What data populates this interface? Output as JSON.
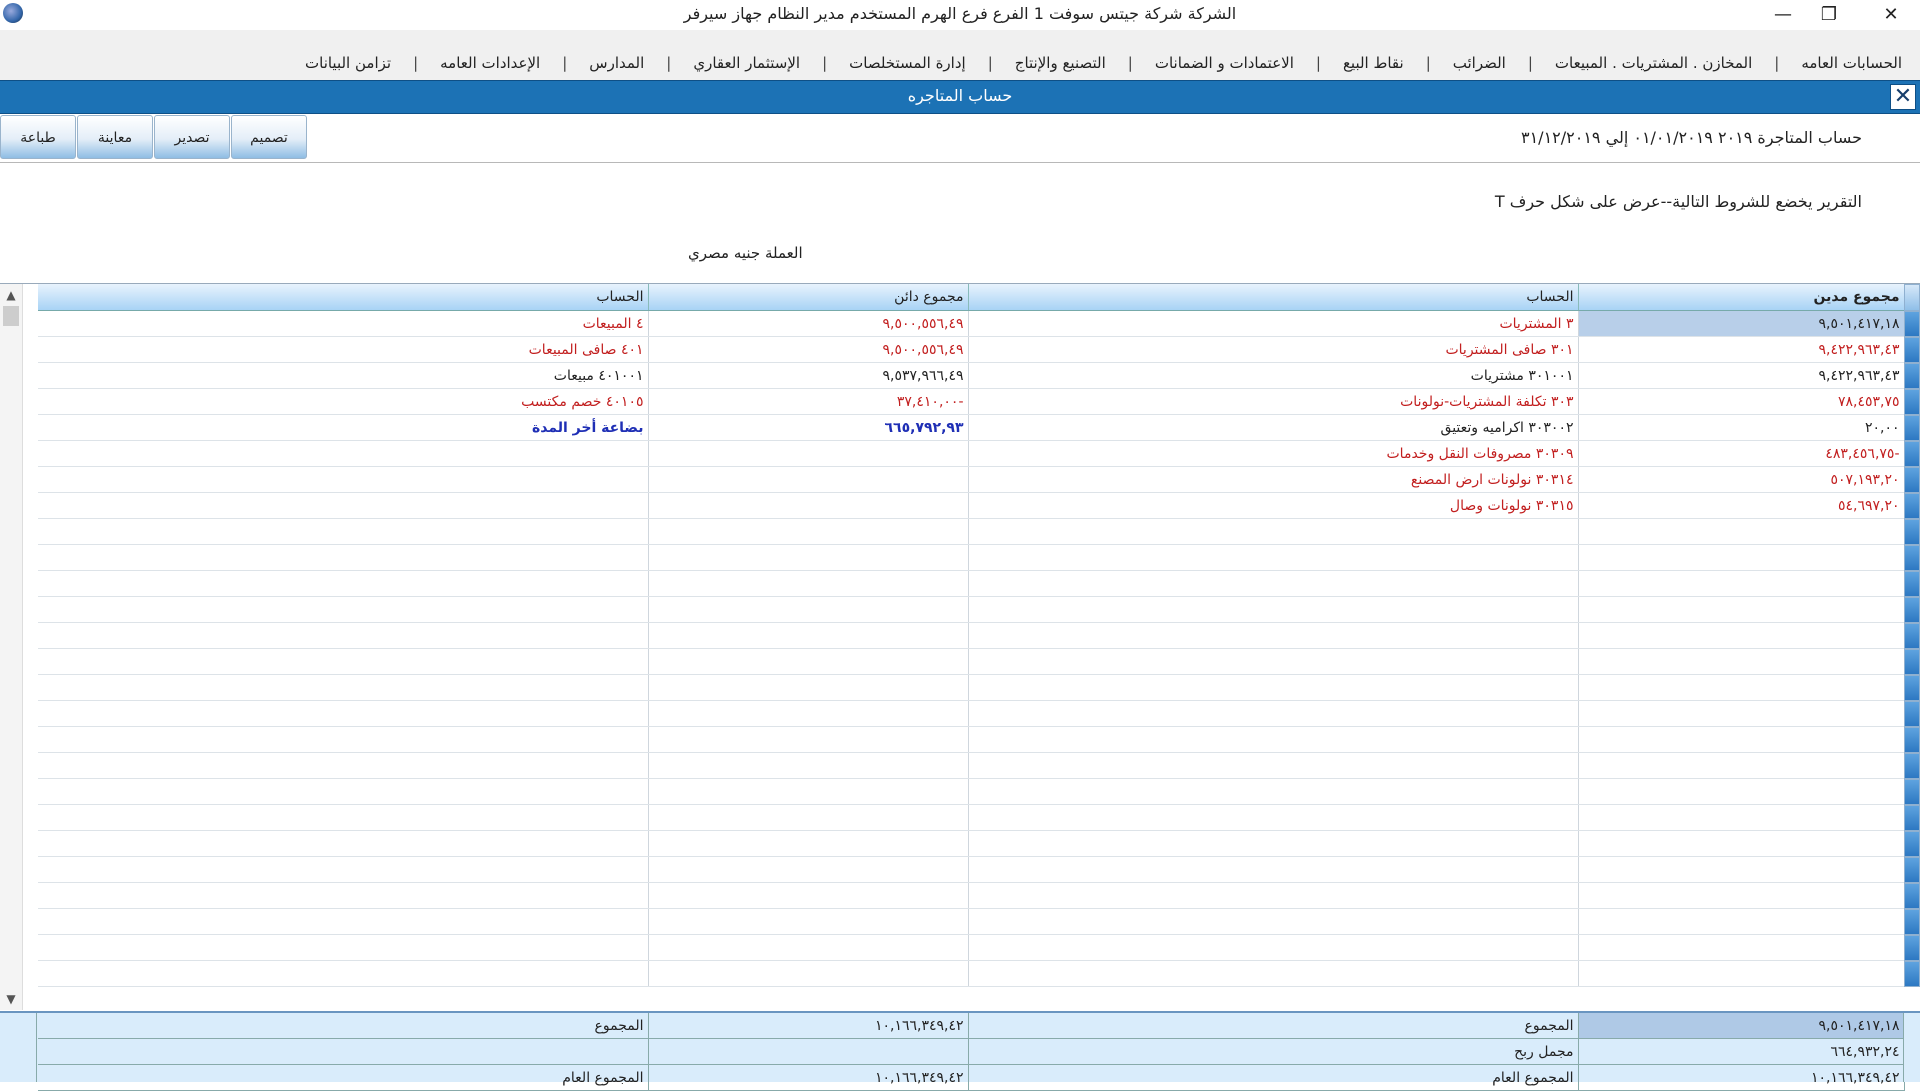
{
  "window": {
    "title": "الشركة شركة جيتس سوفت 1   الفرع فرع الهرم   المستخدم مدير النظام   جهاز سيرفر",
    "minimize": "—",
    "restore": "❐",
    "close": "✕"
  },
  "menu": {
    "items": [
      "الحسابات العامه",
      "المخازن . المشتريات . المبيعات",
      "الضرائب",
      "نقاط البيع",
      "الاعتمادات و الضمانات",
      "التصنيع والإنتاج",
      "إدارة المستخلصات",
      "الإستثمار العقاري",
      "المدارس",
      "الإعدادات العامه",
      "تزامن البيانات"
    ],
    "separator": "|"
  },
  "panel": {
    "title": "حساب المتاجره",
    "close": "✕"
  },
  "toolbar": {
    "design": "تصميم",
    "export": "تصدير",
    "preview": "معاينة",
    "print": "طباعة"
  },
  "report": {
    "title": "حساب المتاجرة ٢٠١٩ ٠١/٠١/٢٠١٩ إلي ٣١/١٢/٢٠١٩",
    "condition": "التقرير يخضع للشروط التالية--عرض على شكل حرف T",
    "currency": "العملة جنيه مصري"
  },
  "grid": {
    "headers": {
      "debit_total": "مجموع مدين",
      "debit_account": "الحساب",
      "credit_total": "مجموع دائن",
      "credit_account": "الحساب"
    },
    "rows": [
      {
        "debit": "٩,٥٠١,٤١٧,١٨",
        "debit_account": "٣ المشتريات",
        "credit": "٩,٥٠٠,٥٥٦,٤٩",
        "credit_account": "٤ المبيعات"
      },
      {
        "debit": "٩,٤٢٢,٩٦٣,٤٣",
        "debit_account": "٣٠١ صافى المشتريات",
        "credit": "٩,٥٠٠,٥٥٦,٤٩",
        "credit_account": "٤٠١ صافى المبيعات"
      },
      {
        "debit": "٩,٤٢٢,٩٦٣,٤٣",
        "debit_account": "٣٠١٠٠١ مشتريات",
        "credit": "٩,٥٣٧,٩٦٦,٤٩",
        "credit_account": "٤٠١٠٠١ مبيعات"
      },
      {
        "debit": "٧٨,٤٥٣,٧٥",
        "debit_account": "٣٠٣ تكلفة المشتريات-نولونات",
        "credit": "٣٧,٤١٠,٠٠-",
        "credit_account": "٤٠١٠٥ خصم مكتسب"
      },
      {
        "debit": "٢٠,٠٠",
        "debit_account": "٣٠٣٠٠٢ اكراميه وتعتيق",
        "credit": "٦٦٥,٧٩٢,٩٣",
        "credit_account": "بضاعة أخر المدة"
      },
      {
        "debit": "٤٨٣,٤٥٦,٧٥-",
        "debit_account": "٣٠٣٠٩ مصروفات النقل وخدمات",
        "credit": "",
        "credit_account": ""
      },
      {
        "debit": "٥٠٧,١٩٣,٢٠",
        "debit_account": "٣٠٣١٤ نولونات ارض المصنع",
        "credit": "",
        "credit_account": ""
      },
      {
        "debit": "٥٤,٦٩٧,٢٠",
        "debit_account": "٣٠٣١٥ نولونات وصال",
        "credit": "",
        "credit_account": ""
      }
    ]
  },
  "footer": {
    "total_label": "المجموع",
    "debit_total": "٩,٥٠١,٤١٧,١٨",
    "credit_total": "١٠,١٦٦,٣٤٩,٤٢",
    "credit_total_label": "المجموع",
    "gross_profit_label": "مجمل ربح",
    "gross_profit": "٦٦٤,٩٣٢,٢٤",
    "grand_total_label": "المجموع العام",
    "grand_debit": "١٠,١٦٦,٣٤٩,٤٢",
    "grand_credit": "١٠,١٦٦,٣٤٩,٤٢",
    "grand_credit_label": "المجموع العام"
  },
  "colors": {
    "header_blue": "#1c72b5",
    "debit_red": "#c21f1f",
    "bold_blue": "#1f2fb5"
  }
}
